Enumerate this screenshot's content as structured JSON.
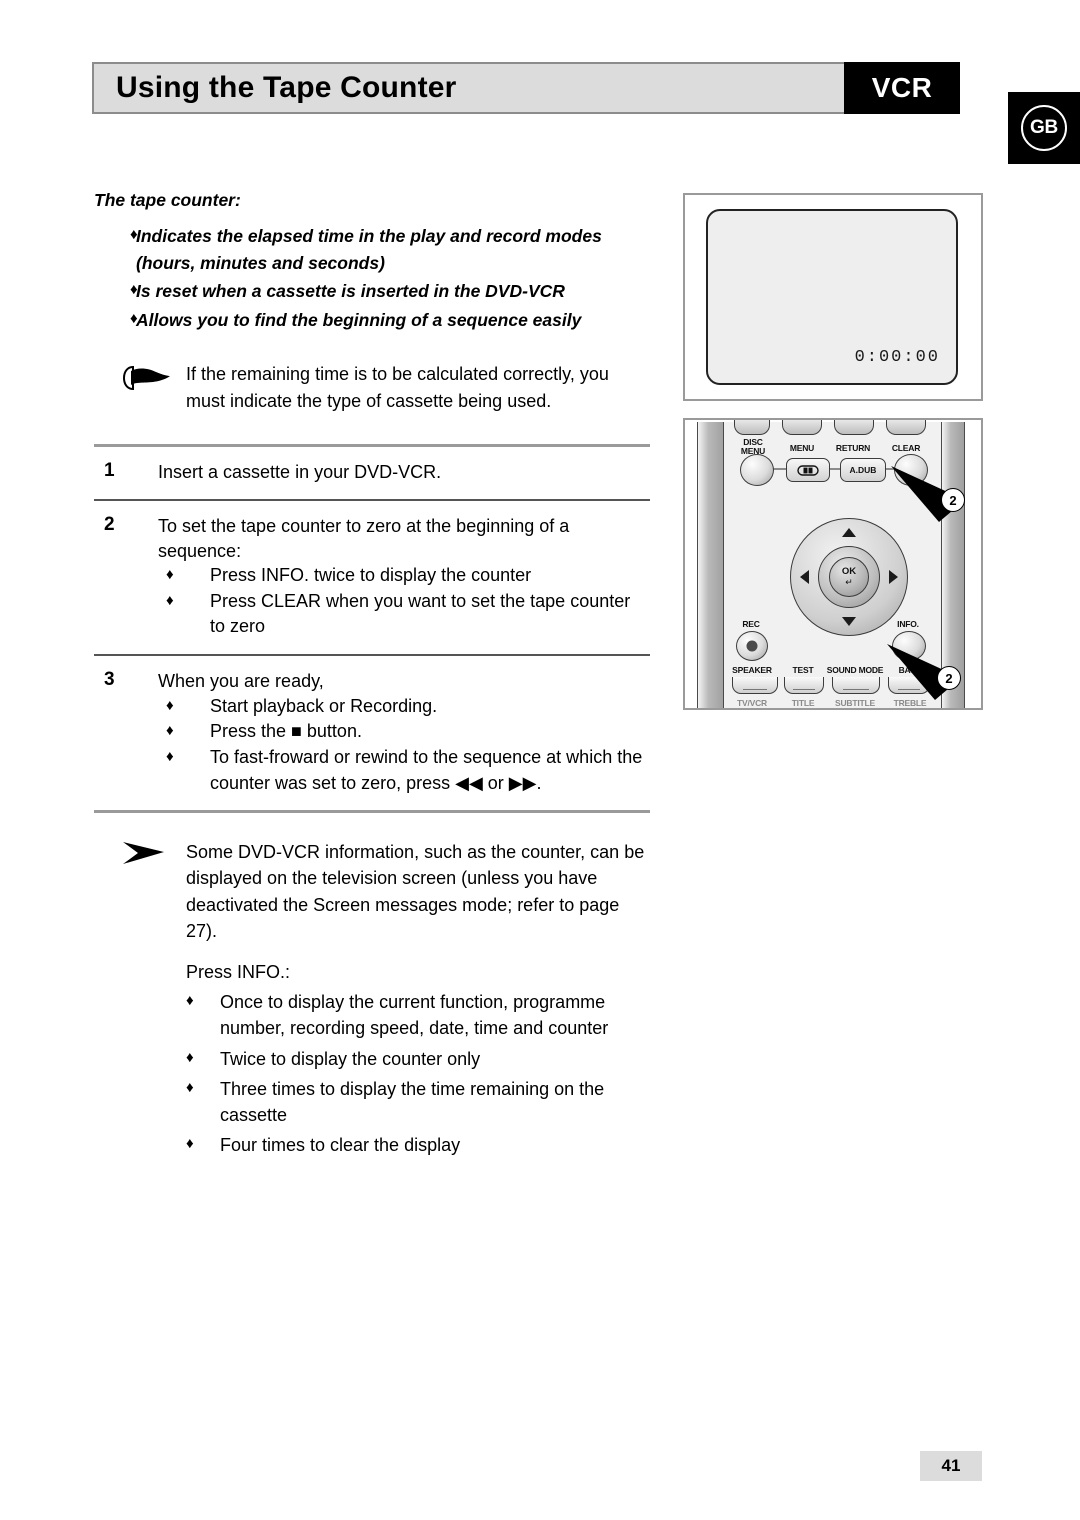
{
  "header": {
    "title": "Using the Tape Counter",
    "mode_badge": "VCR",
    "region_badge": "GB"
  },
  "intro": {
    "heading": "The tape counter:",
    "bullet_glyph": "♦",
    "items": [
      "Indicates the elapsed time in the play and record modes (hours, minutes and seconds)",
      "Is reset when a cassette is inserted in the DVD-VCR",
      "Allows you to find the beginning of a sequence easily"
    ]
  },
  "hand_note": {
    "icon": "pointing-hand-icon",
    "text": "If the remaining time is to be calculated correctly, you must indicate the type of cassette being used."
  },
  "steps": [
    {
      "number": "1",
      "lead": "Insert a cassette in your DVD-VCR.",
      "bullets": []
    },
    {
      "number": "2",
      "lead": "To set the tape counter to zero at the beginning of a sequence:",
      "bullets": [
        "Press INFO. twice to display the counter",
        "Press CLEAR when you want to set the tape counter to zero"
      ]
    },
    {
      "number": "3",
      "lead": "When you are ready,",
      "bullets": [
        "Start playback or Recording.",
        "Press the ■ button.",
        "To fast-froward or rewind to the sequence at which the counter was set to zero, press ◀◀ or ▶▶."
      ]
    }
  ],
  "arrow_note": {
    "icon": "arrowhead-icon",
    "paragraph": "Some DVD-VCR information, such as the counter, can be displayed on the television screen (unless you have deactivated the Screen messages mode; refer to page 27).",
    "press_label": "Press INFO.:",
    "items": [
      "Once to display the current function, programme number, recording speed, date, time and counter",
      "Twice to display the counter only",
      "Three times to display the time remaining on the cassette",
      "Four times to clear the display"
    ]
  },
  "tv_figure": {
    "counter_value": "0:00:00"
  },
  "remote_figure": {
    "labels": {
      "disc_menu": "DISC\nMENU",
      "menu": "MENU",
      "return": "RETURN",
      "clear": "CLEAR",
      "a_dub": "A.DUB",
      "ok": "OK",
      "ok_enter": "↵",
      "rec": "REC",
      "info": "INFO.",
      "speaker": "SPEAKER",
      "test": "TEST",
      "sound_mode": "SOUND MODE",
      "bass": "BASS",
      "tv_vcr": "TV/VCR",
      "title": "TITLE",
      "subtitle": "SUBTITLE",
      "treble": "TREBLE"
    },
    "callouts": [
      {
        "number": "2",
        "target": "clear-button"
      },
      {
        "number": "2",
        "target": "info-button"
      }
    ]
  },
  "footer": {
    "page_number": "41"
  }
}
